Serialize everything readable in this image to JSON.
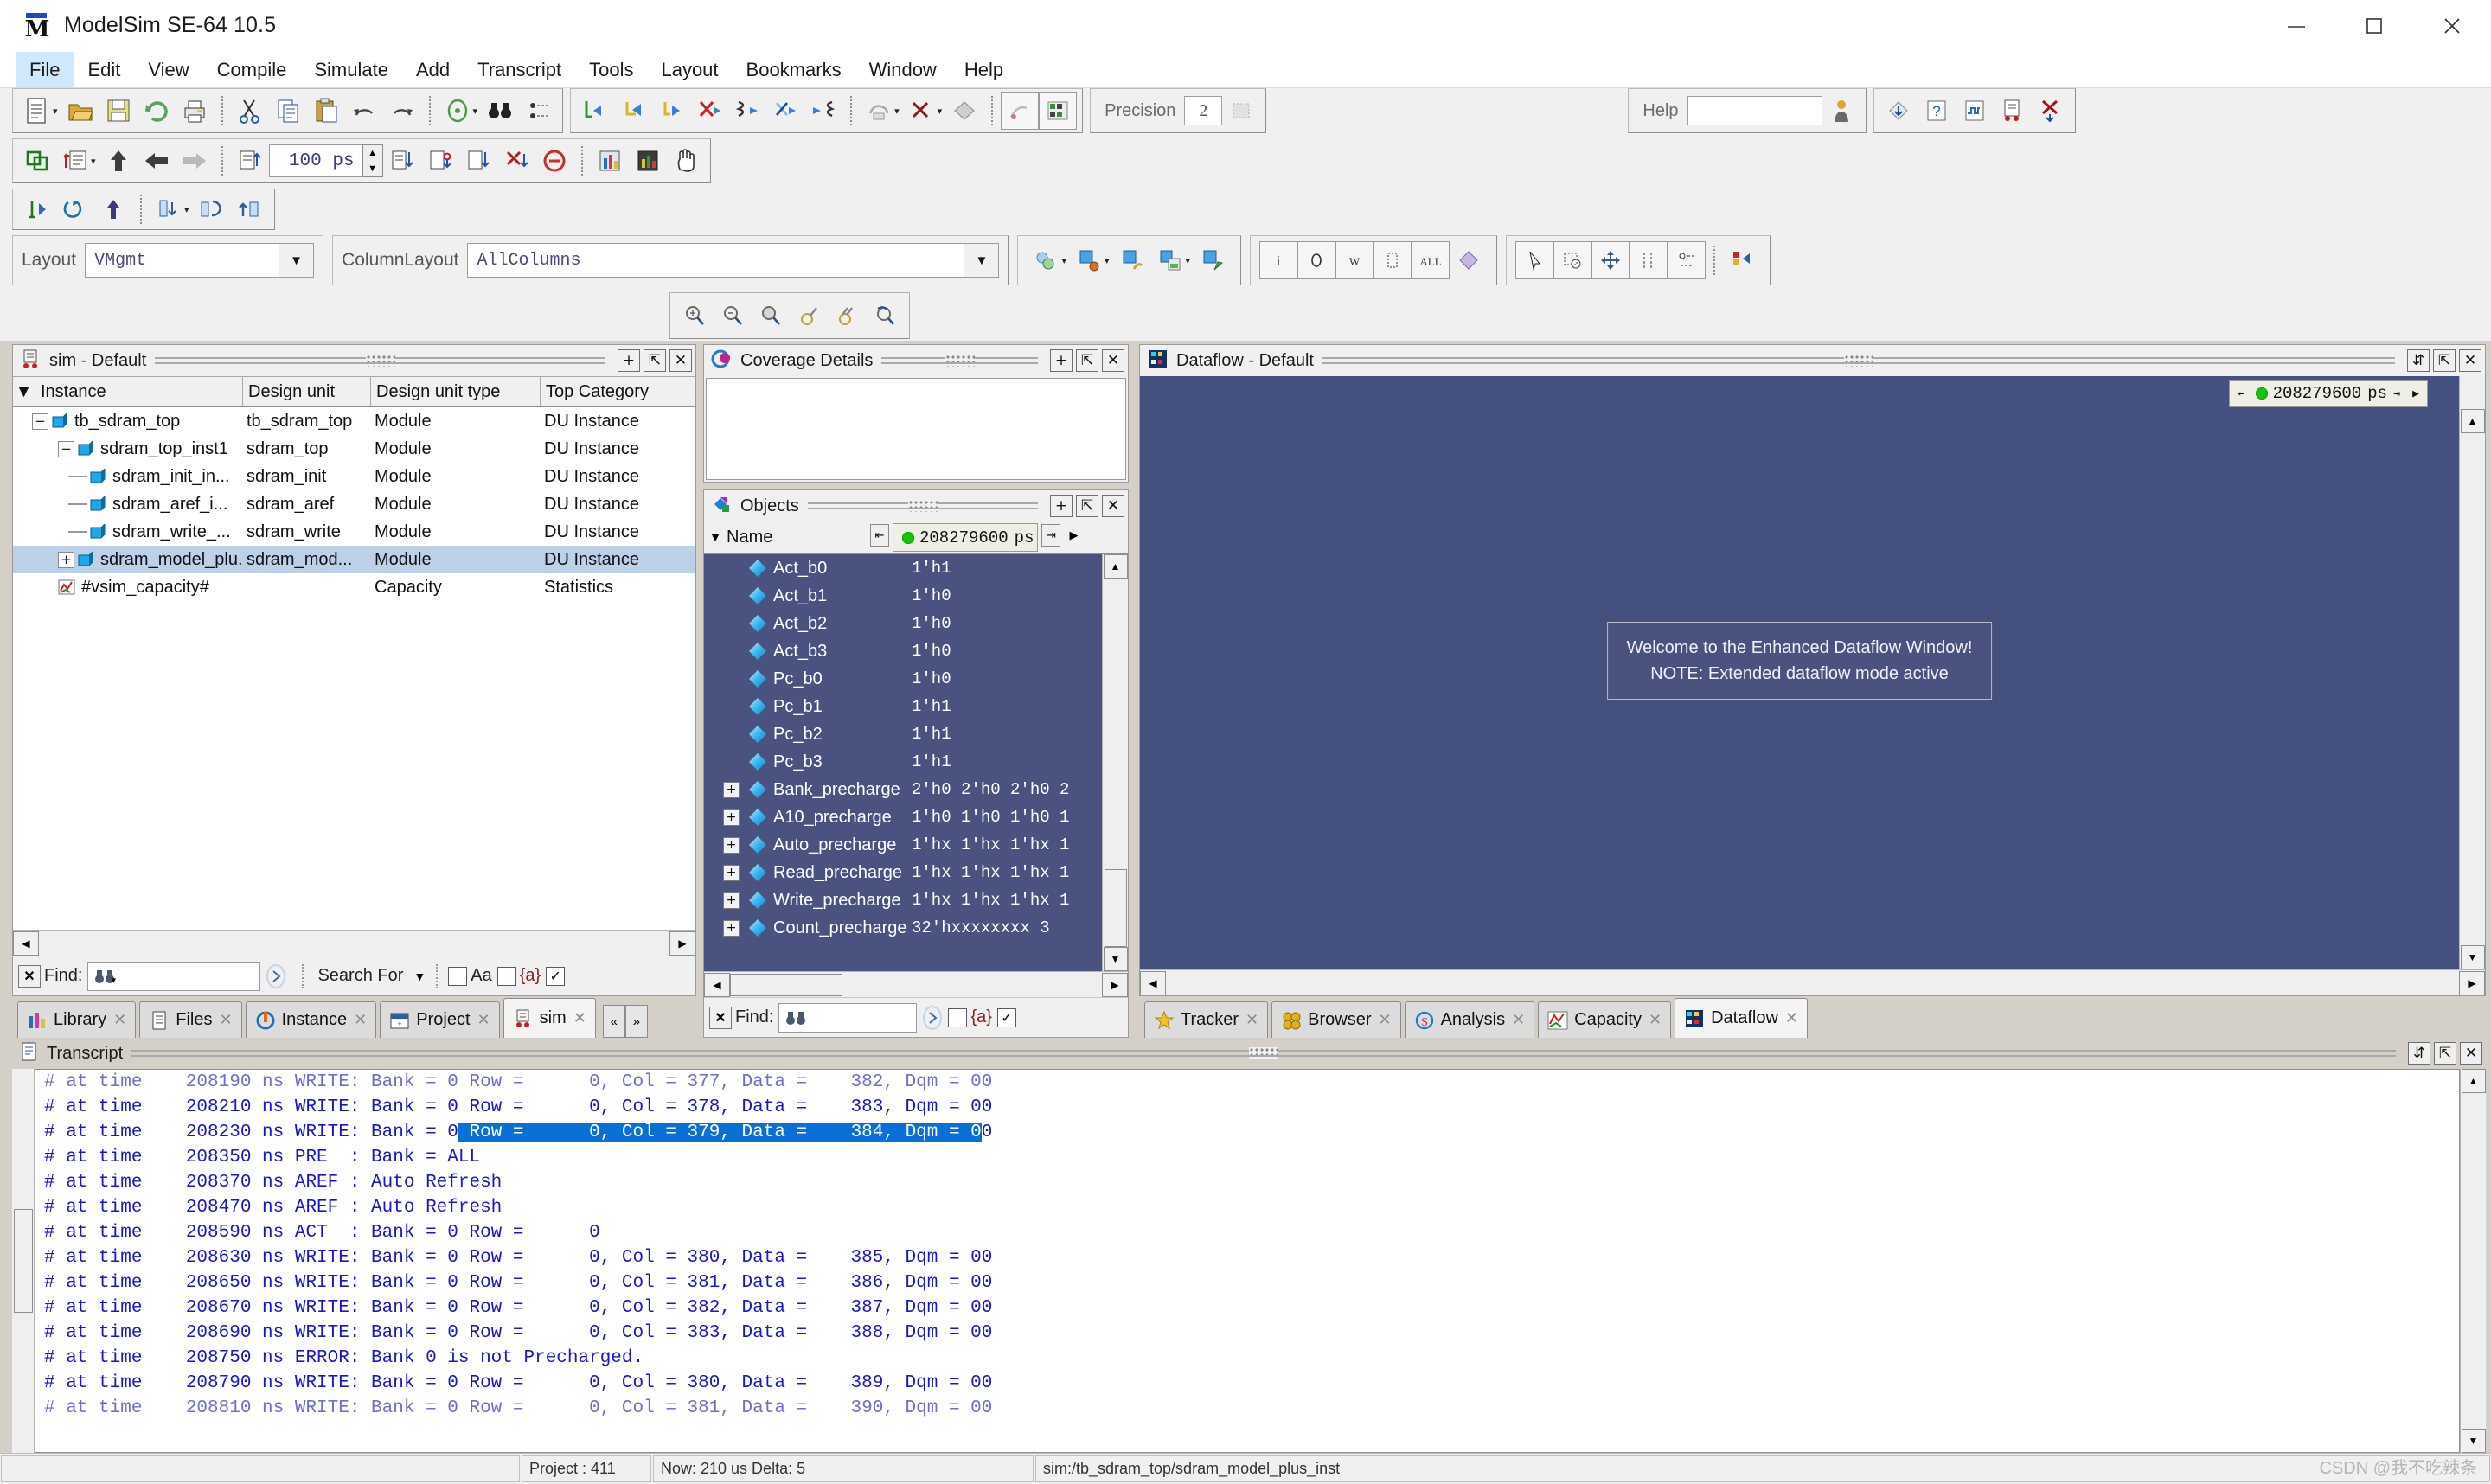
{
  "window": {
    "title": "ModelSim SE-64 10.5",
    "icon": "modelsim-logo-icon",
    "minimize": "minimize-button",
    "maximize": "maximize-button",
    "close": "close-button"
  },
  "menubar": {
    "items": [
      {
        "label": "File",
        "active": true
      },
      {
        "label": "Edit",
        "active": false
      },
      {
        "label": "View",
        "active": false
      },
      {
        "label": "Compile",
        "active": false
      },
      {
        "label": "Simulate",
        "active": false
      },
      {
        "label": "Add",
        "active": false
      },
      {
        "label": "Transcript",
        "active": false
      },
      {
        "label": "Tools",
        "active": false
      },
      {
        "label": "Layout",
        "active": false
      },
      {
        "label": "Bookmarks",
        "active": false
      },
      {
        "label": "Window",
        "active": false
      },
      {
        "label": "Help",
        "active": false
      }
    ]
  },
  "toolbar": {
    "precision_label": "Precision",
    "precision_value": "2",
    "help_label": "Help",
    "help_value": "",
    "step_value": "100 ps",
    "run_length": "100",
    "run_units": "ps"
  },
  "layoutbar": {
    "layout_label": "Layout",
    "layout_value": "VMgmt",
    "columnlayout_label": "ColumnLayout",
    "columnlayout_value": "AllColumns"
  },
  "sim_panel": {
    "title": "sim - Default",
    "columns": [
      "Instance",
      "Design unit",
      "Design unit type",
      "Top Category"
    ],
    "rows": [
      {
        "indent": 0,
        "expander": "-",
        "instance": "tb_sdram_top",
        "design_unit": "tb_sdram_top",
        "design_unit_type": "Module",
        "top_category": "DU Instance",
        "selected": false,
        "icon": "module-icon"
      },
      {
        "indent": 1,
        "expander": "-",
        "instance": "sdram_top_inst1",
        "design_unit": "sdram_top",
        "design_unit_type": "Module",
        "top_category": "DU Instance",
        "selected": false,
        "icon": "module-icon"
      },
      {
        "indent": 2,
        "expander": "",
        "instance": "sdram_init_in...",
        "design_unit": "sdram_init",
        "design_unit_type": "Module",
        "top_category": "DU Instance",
        "selected": false,
        "icon": "module-icon"
      },
      {
        "indent": 2,
        "expander": "",
        "instance": "sdram_aref_i...",
        "design_unit": "sdram_aref",
        "design_unit_type": "Module",
        "top_category": "DU Instance",
        "selected": false,
        "icon": "module-icon"
      },
      {
        "indent": 2,
        "expander": "",
        "instance": "sdram_write_...",
        "design_unit": "sdram_write",
        "design_unit_type": "Module",
        "top_category": "DU Instance",
        "selected": false,
        "icon": "module-icon"
      },
      {
        "indent": 1,
        "expander": "+",
        "instance": "sdram_model_plu...",
        "design_unit": "sdram_mod...",
        "design_unit_type": "Module",
        "top_category": "DU Instance",
        "selected": true,
        "icon": "module-icon"
      },
      {
        "indent": 1,
        "expander": "",
        "instance": "#vsim_capacity#",
        "design_unit": "",
        "design_unit_type": "Capacity",
        "top_category": "Statistics",
        "selected": false,
        "icon": "capacity-icon"
      }
    ],
    "find": {
      "label": "Find:",
      "value": "",
      "search_for_label": "Search For",
      "case_label": "Aa",
      "regex_label": "{a}"
    },
    "tabs": [
      {
        "label": "Library",
        "icon": "library-icon",
        "active": false
      },
      {
        "label": "Files",
        "icon": "files-icon",
        "active": false
      },
      {
        "label": "Instance",
        "icon": "instance-icon",
        "active": false
      },
      {
        "label": "Project",
        "icon": "project-icon",
        "active": false
      },
      {
        "label": "sim",
        "icon": "sim-icon",
        "active": true
      }
    ]
  },
  "coverage_panel": {
    "title": "Coverage Details",
    "icon": "coverage-icon"
  },
  "objects_panel": {
    "title": "Objects",
    "icon": "objects-icon",
    "name_column": "Name",
    "time_value": "208279600",
    "time_units": "ps",
    "rows": [
      {
        "name": "Act_b0",
        "value": "1'h1",
        "expandable": false
      },
      {
        "name": "Act_b1",
        "value": "1'h0",
        "expandable": false
      },
      {
        "name": "Act_b2",
        "value": "1'h0",
        "expandable": false
      },
      {
        "name": "Act_b3",
        "value": "1'h0",
        "expandable": false
      },
      {
        "name": "Pc_b0",
        "value": "1'h0",
        "expandable": false
      },
      {
        "name": "Pc_b1",
        "value": "1'h1",
        "expandable": false
      },
      {
        "name": "Pc_b2",
        "value": "1'h1",
        "expandable": false
      },
      {
        "name": "Pc_b3",
        "value": "1'h1",
        "expandable": false
      },
      {
        "name": "Bank_precharge",
        "value": "2'h0 2'h0 2'h0 2",
        "expandable": true
      },
      {
        "name": "A10_precharge",
        "value": "1'h0 1'h0 1'h0 1",
        "expandable": true
      },
      {
        "name": "Auto_precharge",
        "value": "1'hx 1'hx 1'hx 1",
        "expandable": true
      },
      {
        "name": "Read_precharge",
        "value": "1'hx 1'hx 1'hx 1",
        "expandable": true
      },
      {
        "name": "Write_precharge",
        "value": "1'hx 1'hx 1'hx 1",
        "expandable": true
      },
      {
        "name": "Count_precharge",
        "value": "32'hxxxxxxxx 3",
        "expandable": true
      }
    ],
    "find": {
      "label": "Find:",
      "value": "",
      "regex_label": "{a}"
    }
  },
  "dataflow_panel": {
    "title": "Dataflow - Default",
    "icon": "dataflow-icon",
    "time_value": "208279600",
    "time_units": "ps",
    "welcome_line1": "Welcome to the Enhanced Dataflow Window!",
    "welcome_line2": "NOTE: Extended dataflow mode active",
    "tabs": [
      {
        "label": "Tracker",
        "icon": "tracker-icon",
        "active": false
      },
      {
        "label": "Browser",
        "icon": "browser-icon",
        "active": false
      },
      {
        "label": "Analysis",
        "icon": "analysis-icon",
        "active": false
      },
      {
        "label": "Capacity",
        "icon": "capacity-tab-icon",
        "active": false
      },
      {
        "label": "Dataflow",
        "icon": "dataflow-tab-icon",
        "active": true
      }
    ]
  },
  "transcript_panel": {
    "title": "Transcript",
    "icon": "transcript-icon",
    "lines": [
      {
        "text": "# at time    208190 ns WRITE: Bank = 0 Row =      0, Col = 377, Data =    382, Dqm = 00",
        "faded": true,
        "highlight": null
      },
      {
        "text": "# at time    208210 ns WRITE: Bank = 0 Row =      0, Col = 378, Data =    383, Dqm = 00",
        "faded": false,
        "highlight": null
      },
      {
        "text": "# at time    208230 ns WRITE: Bank = 0 Row =      0, Col = 379, Data =    384, Dqm = 00",
        "faded": false,
        "highlight": {
          "start": 38,
          "end": 86
        }
      },
      {
        "text": "# at time    208350 ns PRE  : Bank = ALL",
        "faded": false,
        "highlight": null
      },
      {
        "text": "# at time    208370 ns AREF : Auto Refresh",
        "faded": false,
        "highlight": null
      },
      {
        "text": "# at time    208470 ns AREF : Auto Refresh",
        "faded": false,
        "highlight": null
      },
      {
        "text": "# at time    208590 ns ACT  : Bank = 0 Row =      0",
        "faded": false,
        "highlight": null
      },
      {
        "text": "# at time    208630 ns WRITE: Bank = 0 Row =      0, Col = 380, Data =    385, Dqm = 00",
        "faded": false,
        "highlight": null
      },
      {
        "text": "# at time    208650 ns WRITE: Bank = 0 Row =      0, Col = 381, Data =    386, Dqm = 00",
        "faded": false,
        "highlight": null
      },
      {
        "text": "# at time    208670 ns WRITE: Bank = 0 Row =      0, Col = 382, Data =    387, Dqm = 00",
        "faded": false,
        "highlight": null
      },
      {
        "text": "# at time    208690 ns WRITE: Bank = 0 Row =      0, Col = 383, Data =    388, Dqm = 00",
        "faded": false,
        "highlight": null
      },
      {
        "text": "# at time    208750 ns ERROR: Bank 0 is not Precharged.",
        "faded": false,
        "highlight": null
      },
      {
        "text": "# at time    208790 ns WRITE: Bank = 0 Row =      0, Col = 380, Data =    389, Dqm = 00",
        "faded": false,
        "highlight": null
      },
      {
        "text": "# at time    208810 ns WRITE: Bank = 0 Row =      0, Col = 381, Data =    390, Dqm = 00",
        "faded": true,
        "highlight": null
      }
    ]
  },
  "statusbar": {
    "project": "Project : 411",
    "now": "Now: 210 us  Delta: 5",
    "context": "sim:/tb_sdram_top/sdram_model_plus_inst"
  },
  "watermark": "CSDN @我不吃辣条"
}
